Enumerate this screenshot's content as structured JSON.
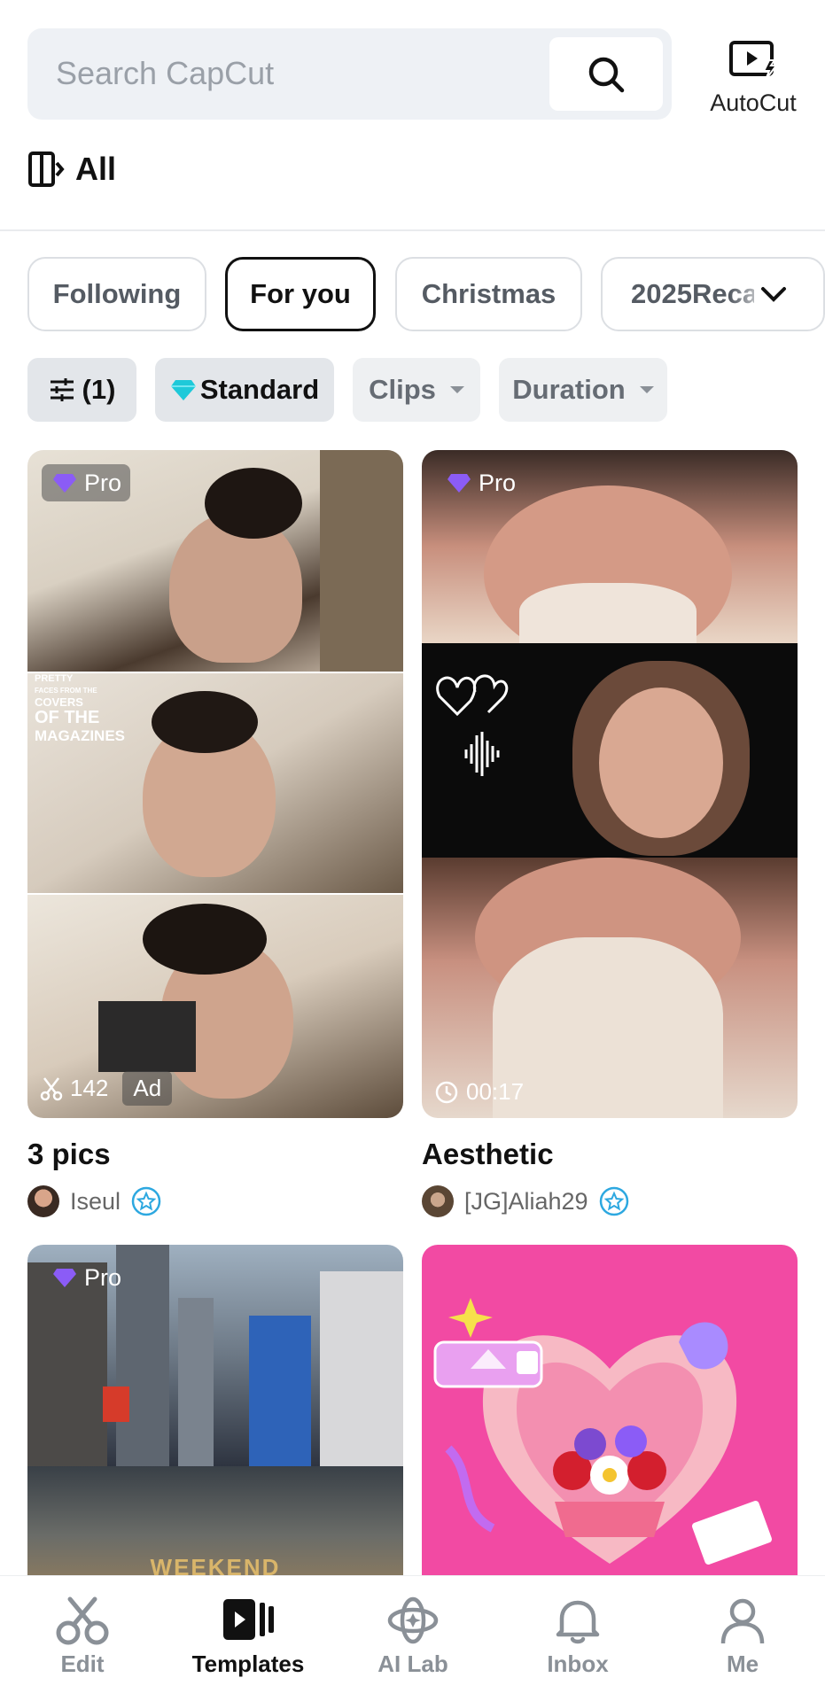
{
  "search": {
    "placeholder": "Search CapCut"
  },
  "autocut": {
    "label": "AutoCut"
  },
  "all": {
    "label": "All"
  },
  "categories": [
    "Following",
    "For you",
    "Christmas",
    "2025Reca"
  ],
  "filters": {
    "settings": "(1)",
    "standard": "Standard",
    "clips": "Clips",
    "duration": "Duration"
  },
  "cards": [
    {
      "title": "3 pics",
      "author": "Iseul",
      "badge": "Pro",
      "stat": "142",
      "ad": "Ad",
      "overlay_text": [
        "PRETTY",
        "FACES FROM THE",
        "COVERS",
        "OF THE",
        "MAGAZINES"
      ]
    },
    {
      "title": "Aesthetic",
      "author": "[JG]Aliah29",
      "badge": "Pro",
      "duration": "00:17"
    },
    {
      "badge": "Pro",
      "overlay_text": "WEEKEND"
    },
    {}
  ],
  "nav": [
    {
      "label": "Edit",
      "icon": "scissors-icon"
    },
    {
      "label": "Templates",
      "icon": "templates-icon"
    },
    {
      "label": "AI Lab",
      "icon": "ai-lab-icon"
    },
    {
      "label": "Inbox",
      "icon": "bell-icon"
    },
    {
      "label": "Me",
      "icon": "person-icon"
    }
  ]
}
